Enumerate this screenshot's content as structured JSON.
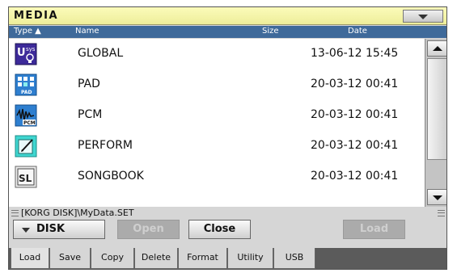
{
  "header": {
    "title": "MEDIA",
    "menu_icon": "chevron-down-icon"
  },
  "columns": {
    "type": "Type",
    "type_sort_indicator": "▲",
    "name": "Name",
    "size": "Size",
    "date": "Date"
  },
  "files": [
    {
      "icon": "global-file-icon",
      "name": "GLOBAL",
      "date": "13-06-12 15:45"
    },
    {
      "icon": "pad-file-icon",
      "name": "PAD",
      "date": "20-03-12 00:41"
    },
    {
      "icon": "pcm-file-icon",
      "name": "PCM",
      "date": "20-03-12 00:41"
    },
    {
      "icon": "perform-file-icon",
      "name": "PERFORM",
      "date": "20-03-12 00:41"
    },
    {
      "icon": "songbook-file-icon",
      "name": "SONGBOOK",
      "date": "20-03-12 00:41"
    }
  ],
  "path": "[KORG DISK]\\MyData.SET",
  "device": {
    "label": "DISK"
  },
  "buttons": {
    "open": "Open",
    "close": "Close",
    "load": "Load"
  },
  "tabs": [
    {
      "label": "Load",
      "active": true
    },
    {
      "label": "Save",
      "active": false
    },
    {
      "label": "Copy",
      "active": false
    },
    {
      "label": "Delete",
      "active": false
    },
    {
      "label": "Format",
      "active": false
    },
    {
      "label": "Utility",
      "active": false
    },
    {
      "label": "USB",
      "active": false
    }
  ],
  "colors": {
    "header_bg": "#f5f5aa",
    "column_header_bg": "#3f6a9a",
    "icon_blue": "#2e7fd0",
    "icon_purple": "#3d2a9a",
    "icon_teal": "#3fd6d0"
  }
}
